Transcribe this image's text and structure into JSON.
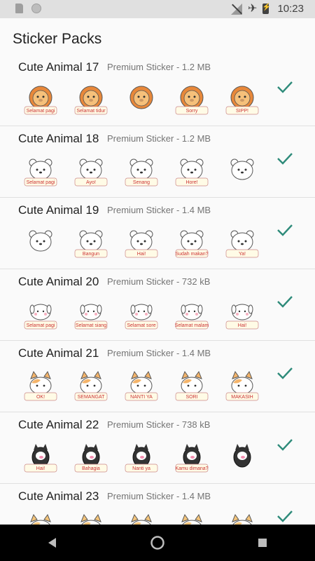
{
  "status_bar": {
    "time": "10:23"
  },
  "header": {
    "title": "Sticker Packs"
  },
  "packs": [
    {
      "name": "Cute Animal 17",
      "meta": "Premium Sticker - 1.2 MB",
      "stickers": [
        "lion-sticker",
        "lion-sticker",
        "lion-sticker",
        "lion-sticker",
        "lion-sticker"
      ],
      "texts": [
        "Selamat pagi",
        "Selamat tidur",
        "",
        "Sorry",
        "SIPP!"
      ],
      "color": "#f4a43a"
    },
    {
      "name": "Cute Animal 18",
      "meta": "Premium Sticker - 1.2 MB",
      "stickers": [
        "bear-sticker",
        "bear-sticker",
        "bear-sticker",
        "bear-sticker",
        "bear-sticker"
      ],
      "texts": [
        "Selamat pagi",
        "Ayo!",
        "Senang",
        "Hore!",
        ""
      ],
      "color": "#ffffff"
    },
    {
      "name": "Cute Animal 19",
      "meta": "Premium Sticker - 1.4 MB",
      "stickers": [
        "bear-sticker",
        "bear-sticker",
        "bear-sticker",
        "bear-sticker",
        "bear-sticker"
      ],
      "texts": [
        "",
        "Bangun",
        "Hai!",
        "Sudah makan?",
        "Ya!"
      ],
      "color": "#ffffff"
    },
    {
      "name": "Cute Animal 20",
      "meta": "Premium Sticker - 732 kB",
      "stickers": [
        "dog-sticker",
        "dog-sticker",
        "dog-sticker",
        "dog-sticker",
        "dog-sticker"
      ],
      "texts": [
        "Selamat pagi",
        "Selamat siang",
        "Selamat sore",
        "Selamat malam",
        "Hai!"
      ],
      "color": "#ffffff"
    },
    {
      "name": "Cute Animal 21",
      "meta": "Premium Sticker - 1.4 MB",
      "stickers": [
        "cat-sticker",
        "cat-sticker",
        "cat-sticker",
        "cat-sticker",
        "cat-sticker"
      ],
      "texts": [
        "OK!",
        "SEMANGAT",
        "NANTI YA",
        "SORI",
        "MAKASIH"
      ],
      "color": "#f4b46a"
    },
    {
      "name": "Cute Animal 22",
      "meta": "Premium Sticker - 738 kB",
      "stickers": [
        "pig-sticker",
        "pig-sticker",
        "pig-sticker",
        "pig-sticker",
        "pig-sticker"
      ],
      "texts": [
        "Hai!",
        "Bahagia",
        "Nanti ya",
        "Kamu dimana?",
        ""
      ],
      "color": "#333333"
    },
    {
      "name": "Cute Animal 23",
      "meta": "Premium Sticker - 1.4 MB",
      "stickers": [
        "cat-sticker",
        "cat-sticker",
        "cat-sticker",
        "cat-sticker",
        "cat-sticker"
      ],
      "texts": [
        "",
        "",
        "",
        "",
        ""
      ],
      "color": "#f4c47a"
    }
  ],
  "nav": {
    "back": "back-icon",
    "home": "home-icon",
    "recents": "recents-icon"
  }
}
